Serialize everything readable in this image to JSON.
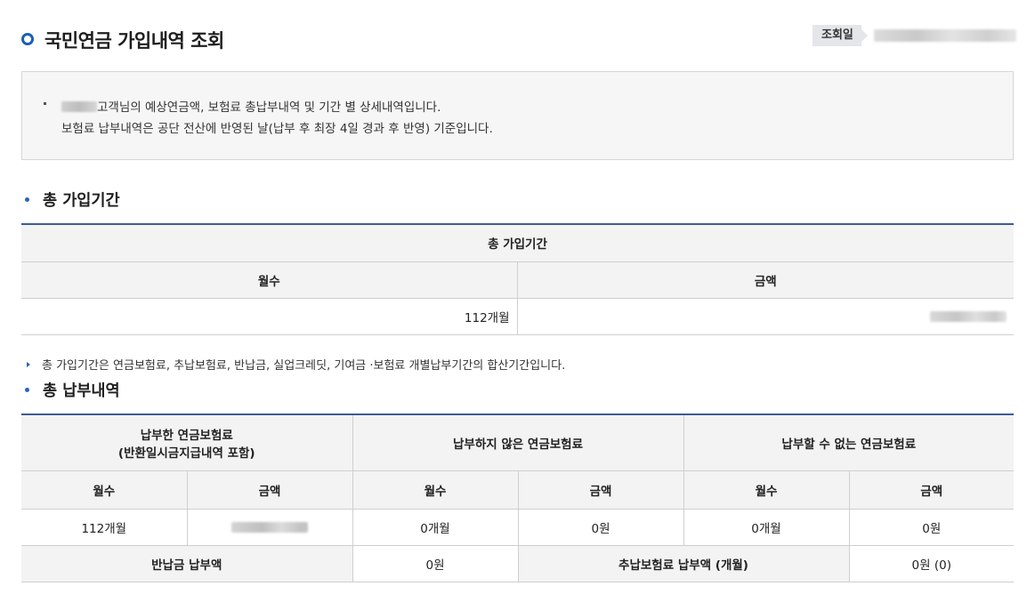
{
  "page": {
    "title": "국민연금 가입내역 조회",
    "date_label": "조회일"
  },
  "notice": {
    "line1_suffix": "고객님의 예상연금액, 보험료 총납부내역 및 기간 별 상세내역입니다.",
    "line2": "보험료 납부내역은 공단 전산에 반영된 날(납부 후 최장 4일 경과 후 반영) 기준입니다."
  },
  "total_period": {
    "section_title": "총 가입기간",
    "table_title": "총 가입기간",
    "col_months": "월수",
    "col_amount": "금액",
    "months_value": "112개월"
  },
  "period_note": "총 가입기간은 연금보험료, 추납보험료, 반납금, 실업크레딧, 기여금 ·보험료 개별납부기간의 합산기간입니다.",
  "payment": {
    "section_title": "총 납부내역",
    "groups": {
      "paid_line1": "납부한 연금보험료",
      "paid_line2": "(반환일시금지급내역 포함)",
      "unpaid": "납부하지 않은 연금보험료",
      "unpayable": "납부할 수 없는 연금보험료"
    },
    "col_months": "월수",
    "col_amount": "금액",
    "paid_months": "112개월",
    "unpaid_months": "0개월",
    "unpaid_amount": "0원",
    "unpayable_months": "0개월",
    "unpayable_amount": "0원",
    "refund_label": "반납금 납부액",
    "refund_value": "0원",
    "supplementary_label": "추납보험료 납부액 (개월)",
    "supplementary_value": "0원 (0)"
  },
  "colors": {
    "accent": "#1a5fb4",
    "table_border_top": "#3d5a96",
    "header_bg": "#f3f3f3",
    "notice_bg": "#f6f6f6"
  },
  "icons": {
    "title": "ring-bullet-icon",
    "section": "dot-bullet-icon",
    "note": "triangle-bullet-icon"
  }
}
